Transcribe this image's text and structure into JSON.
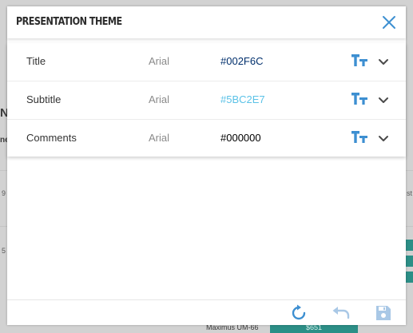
{
  "background": {
    "fragments": [
      "N",
      "ne",
      "9",
      "st",
      "5",
      "Maximus UM-66",
      "$651"
    ]
  },
  "dialog": {
    "title": "PRESENTATION THEME",
    "rows": [
      {
        "name": "Title",
        "font": "Arial",
        "color": "#002F6C",
        "color_hex": "#002F6C"
      },
      {
        "name": "Subtitle",
        "font": "Arial",
        "color": "#5BC2E7",
        "color_hex": "#5BC2E7"
      },
      {
        "name": "Comments",
        "font": "Arial",
        "color": "#000000",
        "color_hex": "#000000"
      }
    ]
  },
  "colors": {
    "accent": "#3d8fd1",
    "footer_disabled": "#a9c8e6"
  },
  "icons": {
    "close": "close-icon",
    "text_size": "text-size-icon",
    "expand": "chevron-down-icon",
    "reset": "refresh-icon",
    "undo": "undo-icon",
    "save": "save-icon"
  }
}
